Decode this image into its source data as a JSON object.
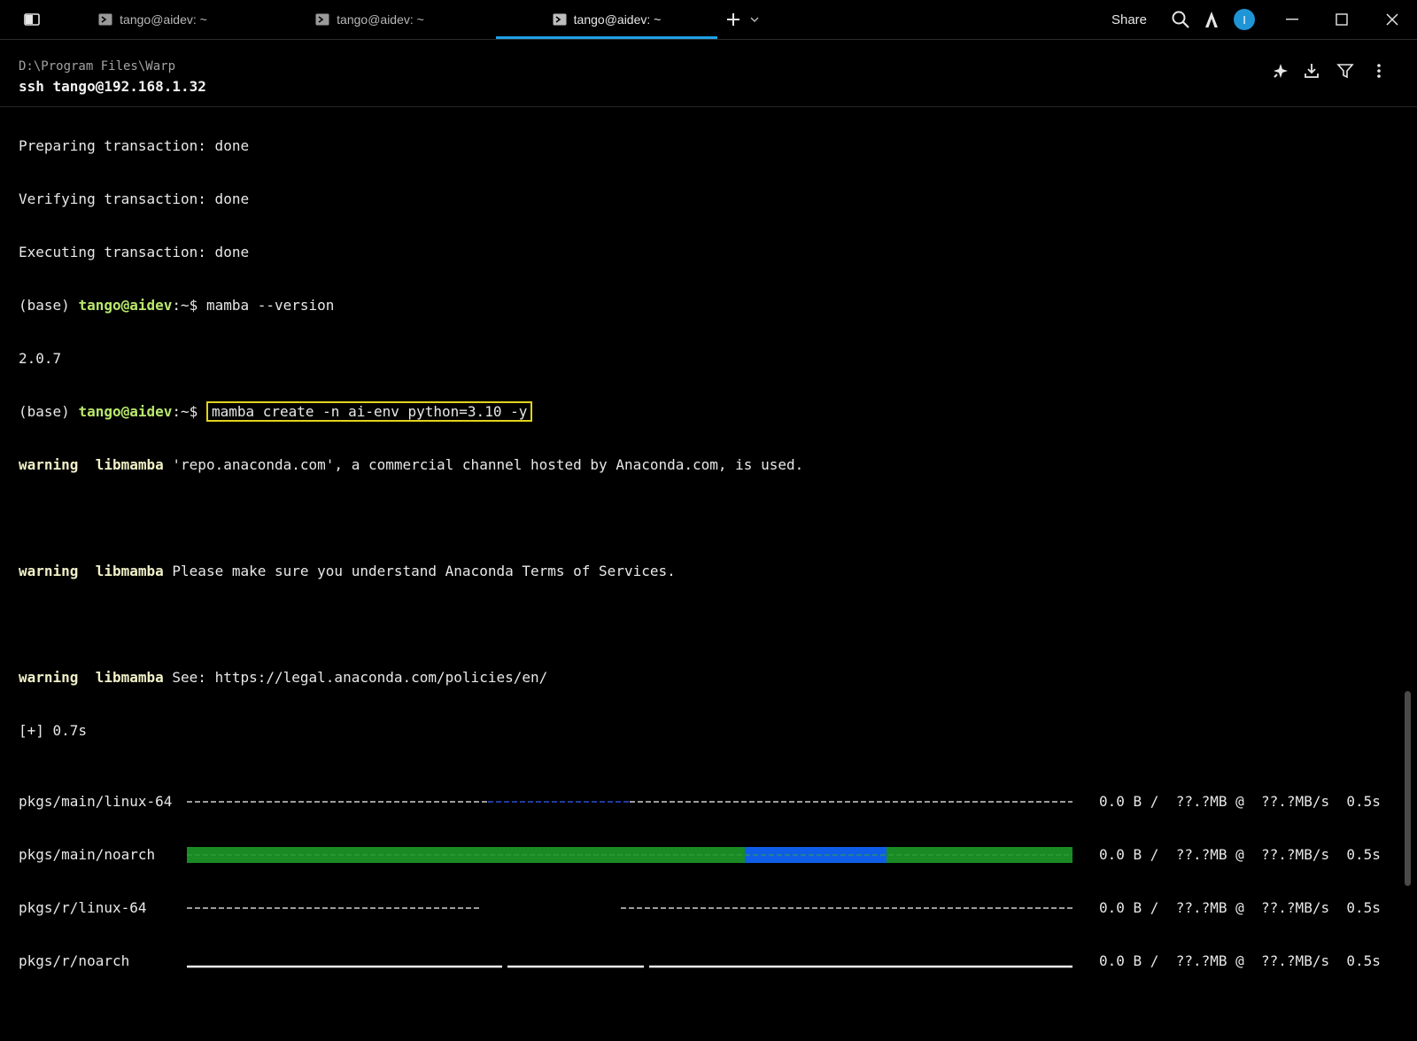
{
  "tabs": [
    {
      "label": "tango@aidev: ~",
      "active": false
    },
    {
      "label": "tango@aidev: ~",
      "active": false
    },
    {
      "label": "tango@aidev: ~",
      "active": true
    }
  ],
  "titlebar": {
    "share_label": "Share",
    "avatar_initial": "I"
  },
  "block_header": {
    "cwd": "D:\\Program Files\\Warp",
    "command": "ssh tango@192.168.1.32"
  },
  "terminal": {
    "lines": [
      "Preparing transaction: done",
      "Verifying transaction: done",
      "Executing transaction: done"
    ],
    "prompt_prefix": "(base) ",
    "prompt_user": "tango@aidev",
    "prompt_suffix": ":~$ ",
    "cmd1": "mamba --version",
    "version": "2.0.7",
    "cmd2": "mamba create -n ai-env python=3.10 -y",
    "warn_word": "warning",
    "warn_lib": "libmamba",
    "warn1": "'repo.anaconda.com', a commercial channel hosted by Anaconda.com, is used.",
    "warn2": "Please make sure you understand Anaconda Terms of Services.",
    "warn3": "See: https://legal.anaconda.com/policies/en/",
    "elapsed": "[+] 0.7s",
    "downloads": [
      {
        "name": "pkgs/main/linux-64",
        "stats": "0.0 B /  ??.?MB @  ??.?MB/s  0.5s"
      },
      {
        "name": "pkgs/main/noarch",
        "stats": "0.0 B /  ??.?MB @  ??.?MB/s  0.5s"
      },
      {
        "name": "pkgs/r/linux-64",
        "stats": "0.0 B /  ??.?MB @  ??.?MB/s  0.5s"
      },
      {
        "name": "pkgs/r/noarch",
        "stats": "0.0 B /  ??.?MB @  ??.?MB/s  0.5s"
      }
    ]
  },
  "colors": {
    "accent": "#1ea1e6",
    "prompt_user": "#b9e86c",
    "highlight_box": "#e2d21a",
    "bar_green": "#1a8a24",
    "bar_blue": "#0f5de6"
  }
}
